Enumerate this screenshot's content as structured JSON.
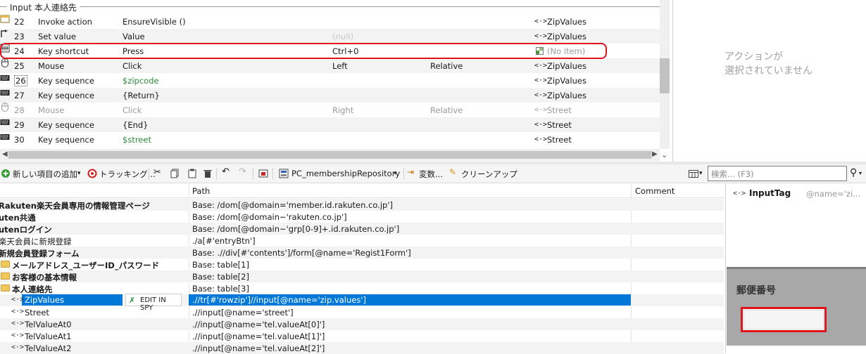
{
  "actions": {
    "group_title": "Input 本人連絡先",
    "rows": [
      {
        "num": "22",
        "type": "Invoke action",
        "value": "EnsureVisible ()",
        "p1": "",
        "p2": "",
        "target": "ZipValues",
        "icon": "invoke-icon"
      },
      {
        "num": "23",
        "type": "Set value",
        "value": "Value",
        "p1": "(null)",
        "p2": "",
        "target": "ZipValues",
        "icon": "set-value-icon"
      },
      {
        "num": "24",
        "type": "Key shortcut",
        "value": "Press",
        "p1": "Ctrl+0",
        "p2": "",
        "target": "(No item)",
        "icon": "key-shortcut-icon"
      },
      {
        "num": "25",
        "type": "Mouse",
        "value": "Click",
        "p1": "Left",
        "p2": "Relative",
        "target": "ZipValues",
        "icon": "mouse-icon"
      },
      {
        "num": "26",
        "type": "Key sequence",
        "value": "$zipcode",
        "p1": "",
        "p2": "",
        "target": "ZipValues",
        "icon": "keyboard-icon"
      },
      {
        "num": "27",
        "type": "Key sequence",
        "value": "{Return}",
        "p1": "",
        "p2": "",
        "target": "ZipValues",
        "icon": "keyboard-icon"
      },
      {
        "num": "28",
        "type": "Mouse",
        "value": "Click",
        "p1": "Right",
        "p2": "Relative",
        "target": "Street",
        "icon": "mouse-icon"
      },
      {
        "num": "29",
        "type": "Key sequence",
        "value": "{End}",
        "p1": "",
        "p2": "",
        "target": "Street",
        "icon": "keyboard-icon"
      },
      {
        "num": "30",
        "type": "Key sequence",
        "value": "$street",
        "p1": "",
        "p2": "",
        "target": "Street",
        "icon": "keyboard-icon"
      }
    ]
  },
  "action_panel": {
    "message_line1": "アクションが",
    "message_line2": "選択されていません"
  },
  "toolbar": {
    "add_new": "新しい項目の追加",
    "tracking": "トラッキング...",
    "repository": "PC_membershipRepository",
    "variables": "変数...",
    "cleanup": "クリーンアップ",
    "search_placeholder": "検索... (F3)"
  },
  "repo": {
    "header_path": "Path",
    "header_comment": "Comment",
    "edit_in_spy": "EDIT IN SPY",
    "rows": [
      {
        "name": "Rakuten楽天会員専用の情報管理ページ",
        "path": "Base: /dom[@domain='member.id.rakuten.co.jp']",
        "bold": true
      },
      {
        "name": "uten共通",
        "path": "Base: /dom[@domain~'rakuten.co.jp']",
        "bold": true
      },
      {
        "name": "utenログイン",
        "path": "Base: /dom[@domain~'grp[0-9]+.id.rakuten.co.jp']",
        "bold": true
      },
      {
        "name": "楽天会員に新規登録",
        "path": "./a[#'entryBtn']",
        "bold": false
      },
      {
        "name": "新規会員登録フォーム",
        "path": "Base: .//div[#'contents']/form[@name='Regist1Form']",
        "bold": true
      },
      {
        "name": "メールアドレス_ユーザーID_パスワード",
        "path": "Base: table[1]",
        "bold": true
      },
      {
        "name": "お客様の基本情報",
        "path": "Base: table[2]",
        "bold": true
      },
      {
        "name": "本人連絡先",
        "path": "Base: table[3]",
        "bold": true
      },
      {
        "name": "ZipValues",
        "path": ".//tr[#'rowzip']//input[@name='zip.values']",
        "bold": false
      },
      {
        "name": "Street",
        "path": ".//input[@name='street']",
        "bold": false
      },
      {
        "name": "TelValueAt0",
        "path": ".//input[@name='tel.valueAt[0]']",
        "bold": false
      },
      {
        "name": "TelValueAt1",
        "path": ".//input[@name='tel.valueAt[1]']",
        "bold": false
      },
      {
        "name": "TelValueAt2",
        "path": ".//input[@name='tel.valueAt[2]']",
        "bold": false
      }
    ]
  },
  "detail": {
    "tag": "InputTag",
    "attr": "@name='zi...",
    "preview_label": "郵便番号"
  },
  "colors": {
    "highlight_red": "#e0141c",
    "selection_blue": "#0078d7",
    "green_variable": "#2f8a3c"
  }
}
